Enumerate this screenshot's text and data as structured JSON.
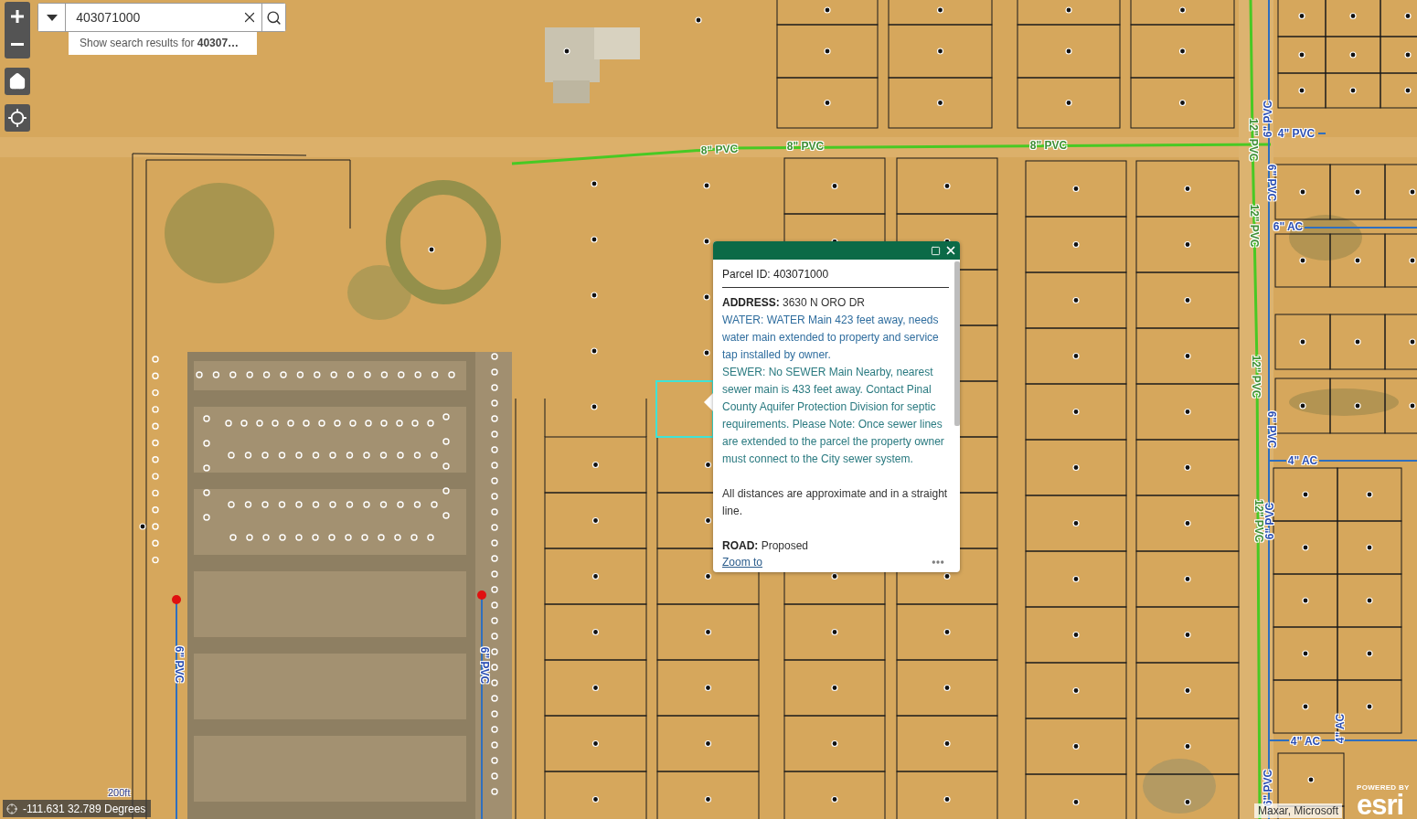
{
  "search": {
    "value": "403071000",
    "suggestion": "Show search results for **40307…**"
  },
  "pipe_labels": [
    {
      "text": "8\" PVC",
      "kind": "water"
    },
    {
      "text": "8\" PVC",
      "kind": "water"
    },
    {
      "text": "8\" PVC",
      "kind": "water"
    },
    {
      "text": "12\" PVC",
      "kind": "water"
    },
    {
      "text": "6\" PVC",
      "kind": "sewer"
    },
    {
      "text": "4\" PVC",
      "kind": "sewer"
    },
    {
      "text": "12\" PVC",
      "kind": "water"
    },
    {
      "text": "6\" PVC",
      "kind": "sewer"
    },
    {
      "text": "6\" AC",
      "kind": "sewer"
    },
    {
      "text": "12\" PVC",
      "kind": "water"
    },
    {
      "text": "6\" PVC",
      "kind": "sewer"
    },
    {
      "text": "4\" AC",
      "kind": "sewer"
    },
    {
      "text": "12\" PVC",
      "kind": "water"
    },
    {
      "text": "6\" PVC",
      "kind": "sewer"
    },
    {
      "text": "4\" AC",
      "kind": "sewer"
    },
    {
      "text": "4\" AC",
      "kind": "sewer"
    },
    {
      "text": "6\" PVC",
      "kind": "sewer"
    },
    {
      "text": "6\" PVC",
      "kind": "sewer"
    },
    {
      "text": "6\" PVC",
      "kind": "sewer"
    }
  ],
  "popup": {
    "title": "Parcel ID: 403071000",
    "fields": [
      {
        "kind": "address",
        "text": "**ADDRESS:** 3630 N ORO DR"
      },
      {
        "kind": "water",
        "text": "WATER: WATER Main 423 feet away, needs water main extended to property and service tap installed by owner."
      },
      {
        "kind": "sewer",
        "text": "SEWER: No SEWER Main Nearby, nearest sewer main is 433 feet away. Contact Pinal County Aquifer Protection Division for septic requirements. Please Note: Once sewer lines are extended to the parcel the property owner must connect to the City sewer system."
      },
      {
        "kind": "note",
        "text": "All distances are approximate and in a straight line."
      },
      {
        "kind": "road",
        "text": "**ROAD:** Proposed"
      }
    ],
    "action": "Zoom to"
  },
  "map": {
    "scale_bar": "200ft",
    "coordinates": "-111.631 32.789 Degrees",
    "attribution": "Maxar, Microsoft",
    "logo": {
      "caption": "POWERED BY",
      "wordmark": "esri"
    }
  }
}
